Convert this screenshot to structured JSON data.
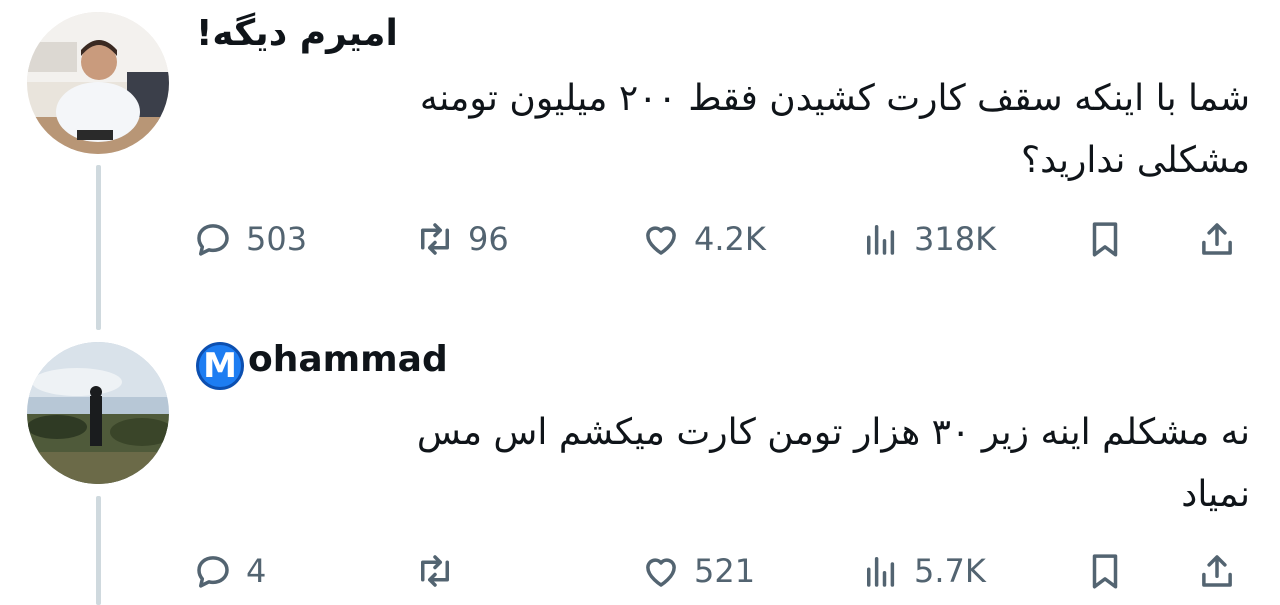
{
  "tweets": [
    {
      "author": "امیرم دیگه!",
      "text_line1": "شما با اینکه سقف کارت کشیدن فقط ۲۰۰ میلیون تومنه",
      "text_line2": "مشکلی ندارید؟",
      "replies": "503",
      "retweets": "96",
      "likes": "4.2K",
      "views": "318K"
    },
    {
      "author_badge": "M",
      "author": "ohammad",
      "text_line1": "نه مشکلم اینه زیر ۳۰ هزار تومن کارت میکشم اس مس",
      "text_line2": "نمیاد",
      "replies": "4",
      "retweets": "",
      "likes": "521",
      "views": "5.7K"
    }
  ],
  "icons": {
    "reply": "reply-icon",
    "retweet": "retweet-icon",
    "like": "heart-icon",
    "views": "views-icon",
    "bookmark": "bookmark-icon",
    "share": "share-icon"
  },
  "colors": {
    "icon_gray": "#536471",
    "thread_line": "#cfd9de",
    "badge_blue": "#1d7df2"
  }
}
